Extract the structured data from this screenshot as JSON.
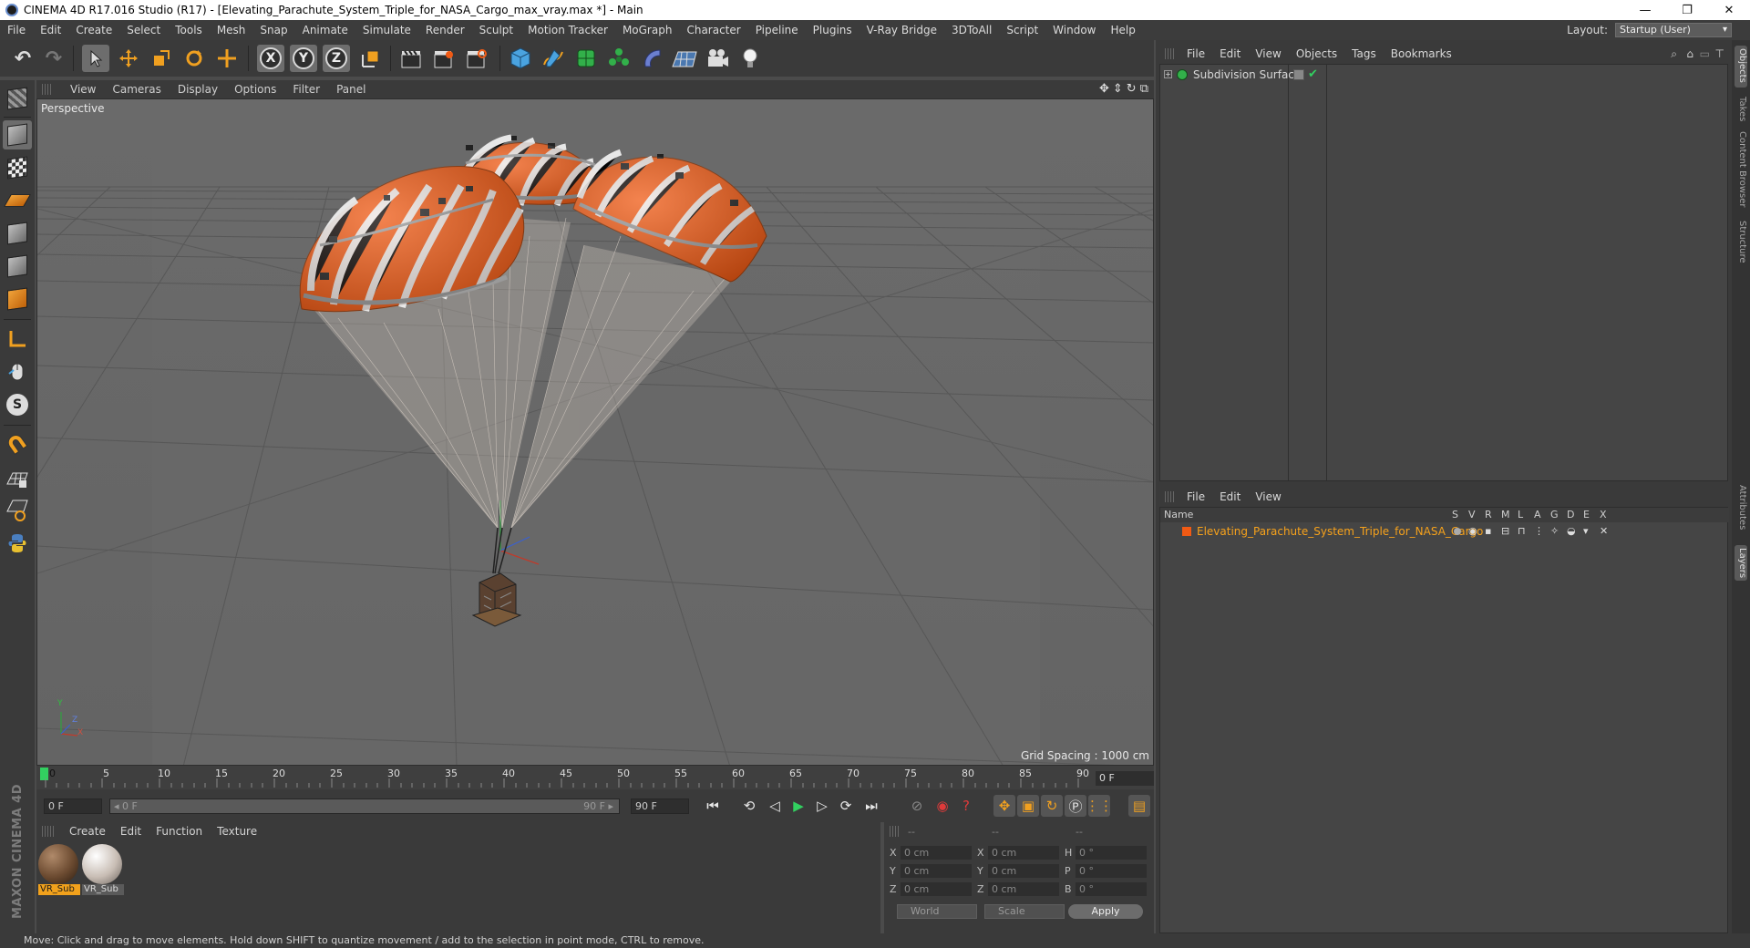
{
  "window": {
    "title": "CINEMA 4D R17.016 Studio (R17) - [Elevating_Parachute_System_Triple_for_NASA_Cargo_max_vray.max *] - Main",
    "minimize": "—",
    "restore": "❐",
    "close": "✕"
  },
  "menu": [
    "File",
    "Edit",
    "Create",
    "Select",
    "Tools",
    "Mesh",
    "Snap",
    "Animate",
    "Simulate",
    "Render",
    "Sculpt",
    "Motion Tracker",
    "MoGraph",
    "Character",
    "Pipeline",
    "Plugins",
    "V-Ray Bridge",
    "3DToAll",
    "Script",
    "Window",
    "Help"
  ],
  "layout": {
    "label": "Layout:",
    "value": "Startup (User)"
  },
  "toolbar": {
    "undo": "↶",
    "redo": "↷",
    "x_axis": "X",
    "y_axis": "Y",
    "z_axis": "Z"
  },
  "viewport": {
    "menu": [
      "View",
      "Cameras",
      "Display",
      "Options",
      "Filter",
      "Panel"
    ],
    "label": "Perspective",
    "grid_spacing": "Grid Spacing : 1000 cm",
    "axis_y": "Y",
    "axis_x": "X",
    "axis_z": "Z"
  },
  "timeline": {
    "ticks": [
      "0",
      "5",
      "10",
      "15",
      "20",
      "25",
      "30",
      "35",
      "40",
      "45",
      "50",
      "55",
      "60",
      "65",
      "70",
      "75",
      "80",
      "85",
      "90"
    ],
    "current_frame": "0 F",
    "start_field": "0 F",
    "range_start": "◂ 0 F",
    "range_end": "90 F ▸",
    "end_field": "90 F"
  },
  "material_manager": {
    "menu": [
      "Create",
      "Edit",
      "Function",
      "Texture"
    ],
    "materials": [
      {
        "name": "VR_Sub",
        "color": "#6b4a30"
      },
      {
        "name": "VR_Sub",
        "color": "#c8bdb4"
      }
    ]
  },
  "coordinates": {
    "header": [
      "--",
      "--",
      "--"
    ],
    "rows": [
      {
        "a1": "X",
        "v1": "0 cm",
        "a2": "X",
        "v2": "0 cm",
        "a3": "H",
        "v3": "0 °"
      },
      {
        "a1": "Y",
        "v1": "0 cm",
        "a2": "Y",
        "v2": "0 cm",
        "a3": "P",
        "v3": "0 °"
      },
      {
        "a1": "Z",
        "v1": "0 cm",
        "a2": "Z",
        "v2": "0 cm",
        "a3": "B",
        "v3": "0 °"
      }
    ],
    "world": "World",
    "scale": "Scale",
    "apply": "Apply"
  },
  "objects_panel": {
    "menu": [
      "File",
      "Edit",
      "View",
      "Objects",
      "Tags",
      "Bookmarks"
    ],
    "object": "Subdivision Surface"
  },
  "layers_panel": {
    "menu": [
      "File",
      "Edit",
      "View"
    ],
    "columns": {
      "name": "Name",
      "flags": [
        "S",
        "V",
        "R",
        "M",
        "L",
        "A",
        "G",
        "D",
        "E",
        "X"
      ]
    },
    "layer": "Elevating_Parachute_System_Triple_for_NASA_Cargo"
  },
  "side_tabs": [
    "Objects",
    "Takes",
    "Content Browser",
    "Structure",
    "Attributes",
    "Layers"
  ],
  "status": "Move: Click and drag to move elements. Hold down SHIFT to quantize movement / add to the selection in point mode, CTRL to remove.",
  "brand": "MAXON CINEMA 4D",
  "colors": {
    "accent": "#f7a21b",
    "parachute_orange": "#f05a14",
    "selection_green": "#32d060"
  }
}
